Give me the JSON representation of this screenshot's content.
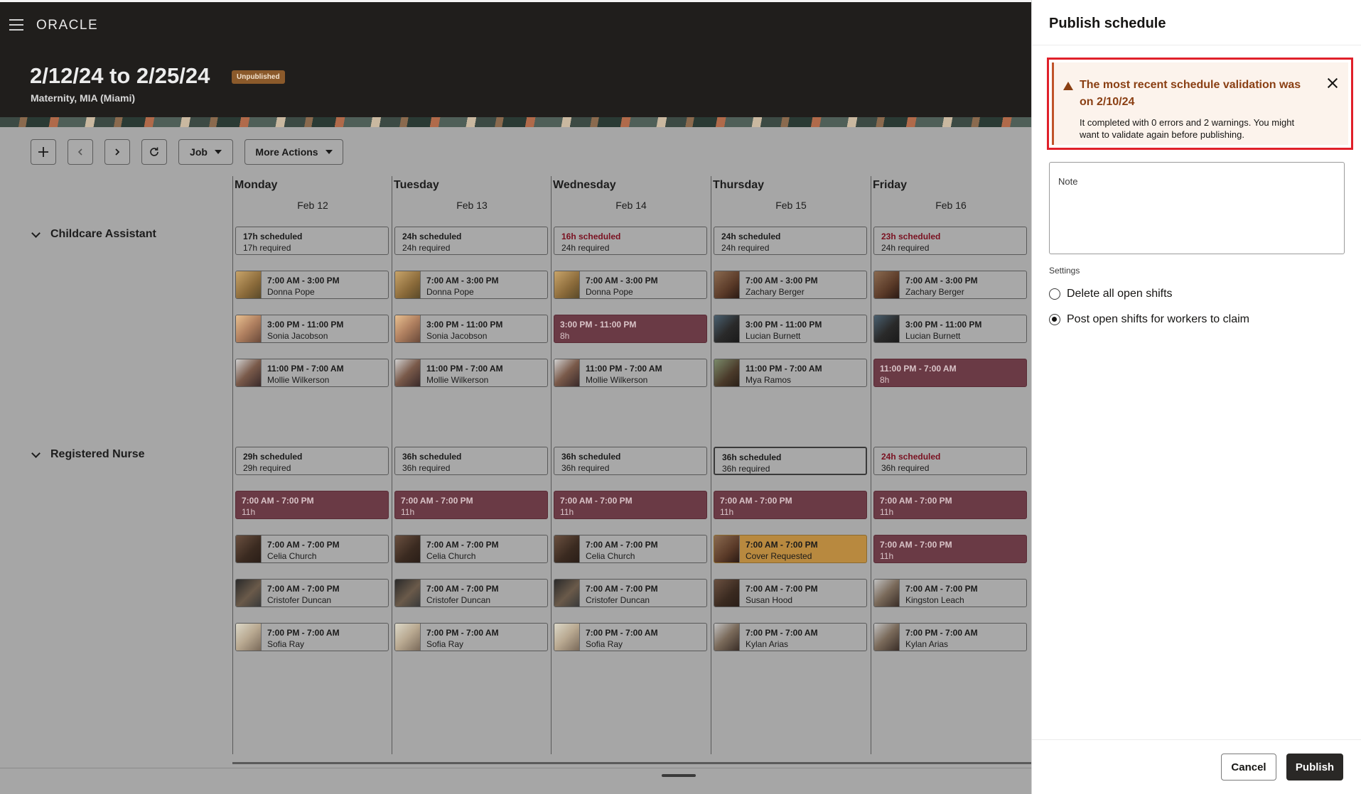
{
  "header": {
    "logo": "ORACLE",
    "date_range": "2/12/24 to 2/25/24",
    "status": "Unpublished",
    "location": "Maternity, MIA (Miami)"
  },
  "toolbar": {
    "job_label": "Job",
    "more_actions_label": "More Actions"
  },
  "days": [
    {
      "name": "Monday",
      "date": "Feb 12"
    },
    {
      "name": "Tuesday",
      "date": "Feb 13"
    },
    {
      "name": "Wednesday",
      "date": "Feb 14"
    },
    {
      "name": "Thursday",
      "date": "Feb 15"
    },
    {
      "name": "Friday",
      "date": "Feb 16"
    }
  ],
  "groups": [
    {
      "label": "Childcare Assistant",
      "summary": [
        {
          "scheduled": "17h scheduled",
          "required": "17h required",
          "alert": false
        },
        {
          "scheduled": "24h scheduled",
          "required": "24h required",
          "alert": false
        },
        {
          "scheduled": "16h scheduled",
          "required": "24h required",
          "alert": true
        },
        {
          "scheduled": "24h scheduled",
          "required": "24h required",
          "alert": false
        },
        {
          "scheduled": "23h scheduled",
          "required": "24h required",
          "alert": true
        }
      ],
      "rows": [
        [
          {
            "type": "assigned",
            "time": "7:00 AM - 3:00 PM",
            "name": "Donna Pope",
            "avatar": "av-a"
          },
          {
            "type": "assigned",
            "time": "7:00 AM - 3:00 PM",
            "name": "Donna Pope",
            "avatar": "av-a"
          },
          {
            "type": "assigned",
            "time": "7:00 AM - 3:00 PM",
            "name": "Donna Pope",
            "avatar": "av-a"
          },
          {
            "type": "assigned",
            "time": "7:00 AM - 3:00 PM",
            "name": "Zachary Berger",
            "avatar": "av-h"
          },
          {
            "type": "assigned",
            "time": "7:00 AM - 3:00 PM",
            "name": "Zachary Berger",
            "avatar": "av-h"
          }
        ],
        [
          {
            "type": "assigned",
            "time": "3:00 PM - 11:00 PM",
            "name": "Sonia Jacobson",
            "avatar": "av-b"
          },
          {
            "type": "assigned",
            "time": "3:00 PM - 11:00 PM",
            "name": "Sonia Jacobson",
            "avatar": "av-b"
          },
          {
            "type": "open",
            "time": "3:00 PM - 11:00 PM",
            "name": "8h"
          },
          {
            "type": "assigned",
            "time": "3:00 PM - 11:00 PM",
            "name": "Lucian Burnett",
            "avatar": "av-e"
          },
          {
            "type": "assigned",
            "time": "3:00 PM - 11:00 PM",
            "name": "Lucian Burnett",
            "avatar": "av-e"
          }
        ],
        [
          {
            "type": "assigned",
            "time": "11:00 PM - 7:00 AM",
            "name": "Mollie Wilkerson",
            "avatar": "av-c"
          },
          {
            "type": "assigned",
            "time": "11:00 PM - 7:00 AM",
            "name": "Mollie Wilkerson",
            "avatar": "av-c"
          },
          {
            "type": "assigned",
            "time": "11:00 PM - 7:00 AM",
            "name": "Mollie Wilkerson",
            "avatar": "av-c"
          },
          {
            "type": "assigned",
            "time": "11:00 PM - 7:00 AM",
            "name": "Mya Ramos",
            "avatar": "av-f"
          },
          {
            "type": "open",
            "time": "11:00 PM - 7:00 AM",
            "name": "8h"
          }
        ]
      ]
    },
    {
      "label": "Registered Nurse",
      "summary": [
        {
          "scheduled": "29h scheduled",
          "required": "29h required",
          "alert": false
        },
        {
          "scheduled": "36h scheduled",
          "required": "36h required",
          "alert": false
        },
        {
          "scheduled": "36h scheduled",
          "required": "36h required",
          "alert": false
        },
        {
          "scheduled": "36h scheduled",
          "required": "36h required",
          "alert": false
        },
        {
          "scheduled": "24h scheduled",
          "required": "36h required",
          "alert": true
        }
      ],
      "rows": [
        [
          {
            "type": "open",
            "time": "7:00 AM - 7:00 PM",
            "name": "11h"
          },
          {
            "type": "open",
            "time": "7:00 AM - 7:00 PM",
            "name": "11h"
          },
          {
            "type": "open",
            "time": "7:00 AM - 7:00 PM",
            "name": "11h"
          },
          {
            "type": "open",
            "time": "7:00 AM - 7:00 PM",
            "name": "11h"
          },
          {
            "type": "open",
            "time": "7:00 AM - 7:00 PM",
            "name": "11h"
          }
        ],
        [
          {
            "type": "assigned",
            "time": "7:00 AM - 7:00 PM",
            "name": "Celia Church",
            "avatar": "av-d"
          },
          {
            "type": "assigned",
            "time": "7:00 AM - 7:00 PM",
            "name": "Celia Church",
            "avatar": "av-d"
          },
          {
            "type": "assigned",
            "time": "7:00 AM - 7:00 PM",
            "name": "Celia Church",
            "avatar": "av-d"
          },
          {
            "type": "cover",
            "time": "7:00 AM - 7:00 PM",
            "name": "Cover Requested",
            "avatar": "av-h"
          },
          {
            "type": "open",
            "time": "7:00 AM - 7:00 PM",
            "name": "11h"
          }
        ],
        [
          {
            "type": "assigned",
            "time": "7:00 AM - 7:00 PM",
            "name": "Cristofer Duncan",
            "avatar": "av-j"
          },
          {
            "type": "assigned",
            "time": "7:00 AM - 7:00 PM",
            "name": "Cristofer Duncan",
            "avatar": "av-j"
          },
          {
            "type": "assigned",
            "time": "7:00 AM - 7:00 PM",
            "name": "Cristofer Duncan",
            "avatar": "av-j"
          },
          {
            "type": "assigned",
            "time": "7:00 AM - 7:00 PM",
            "name": "Susan Hood",
            "avatar": "av-d"
          },
          {
            "type": "assigned",
            "time": "7:00 AM - 7:00 PM",
            "name": "Kingston Leach",
            "avatar": "av-g"
          }
        ],
        [
          {
            "type": "assigned",
            "time": "7:00 PM - 7:00 AM",
            "name": "Sofia Ray",
            "avatar": "av-i"
          },
          {
            "type": "assigned",
            "time": "7:00 PM - 7:00 AM",
            "name": "Sofia Ray",
            "avatar": "av-i"
          },
          {
            "type": "assigned",
            "time": "7:00 PM - 7:00 AM",
            "name": "Sofia Ray",
            "avatar": "av-i"
          },
          {
            "type": "assigned",
            "time": "7:00 PM - 7:00 AM",
            "name": "Kylan Arias",
            "avatar": "av-g"
          },
          {
            "type": "assigned",
            "time": "7:00 PM - 7:00 AM",
            "name": "Kylan Arias",
            "avatar": "av-g"
          }
        ]
      ]
    }
  ],
  "drawer": {
    "title": "Publish schedule",
    "message": {
      "title": "The most recent schedule validation was on 2/10/24",
      "body": "It completed with 0 errors and 2 warnings. You might want to validate again before publishing."
    },
    "note_label": "Note",
    "note_value": "",
    "settings_label": "Settings",
    "options": [
      {
        "label": "Delete all open shifts",
        "checked": false
      },
      {
        "label": "Post open shifts for workers to claim",
        "checked": true
      }
    ],
    "cancel_label": "Cancel",
    "publish_label": "Publish"
  },
  "colors": {
    "topbar": "#201e1c",
    "open_shift": "#6a3a45",
    "cover_requested": "#b8893f",
    "warning_text": "#8a3f13",
    "highlight_outline": "#e0202a"
  }
}
